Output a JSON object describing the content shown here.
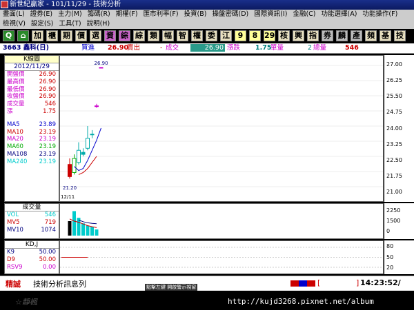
{
  "window": {
    "title": "新世紀贏家 - 101/11/29 - 技術分析"
  },
  "menu": {
    "row1": [
      "畫面(L)",
      "證券(E)",
      "主力(M)",
      "籌碼(R)",
      "期權(F)",
      "匯市利率(F)",
      "投資(B)",
      "操盤密碼(D)",
      "國際資訊(I)",
      "金融(C)",
      "功能選擇(A)",
      "功能操作(F)"
    ],
    "row2": [
      "檢視(V)",
      "設定(S)",
      "工具(T)",
      "說明(H)"
    ]
  },
  "toolbar": {
    "buttons": [
      "Q",
      "⌂",
      "加",
      "櫃",
      "期",
      "價",
      "選",
      "資",
      "綜",
      "綜",
      "類",
      "幅",
      "智",
      "權",
      "委",
      "江",
      "9",
      "8",
      "29",
      "核",
      "興",
      "指",
      "券",
      "麟",
      "產",
      "頻",
      "基",
      "技"
    ]
  },
  "quote": {
    "code_name": "3663 鑫科(日)",
    "bid_label": "買進",
    "bid": "26.90",
    "ask_label": "賣出",
    "ask": "-",
    "trade_label": "成交",
    "trade": "26.90",
    "change_label": "漲跌",
    "change": "1.75",
    "unit_vol_label": "單量",
    "unit_vol": "2",
    "total_vol_label": "總量",
    "total_vol": "546"
  },
  "kline": {
    "title": "K線圖",
    "date": "2012/11/29",
    "stats": [
      {
        "label": "開盤價",
        "value": "26.90"
      },
      {
        "label": "最高價",
        "value": "26.90"
      },
      {
        "label": "最低價",
        "value": "26.90"
      },
      {
        "label": "收盤價",
        "value": "26.90"
      },
      {
        "label": "成交量",
        "value": "546"
      },
      {
        "label": "漲",
        "value": "1.75"
      }
    ],
    "ma": [
      {
        "label": "MA5",
        "value": "23.89",
        "color": "#0000cc"
      },
      {
        "label": "MA10",
        "value": "23.19",
        "color": "#cc0000"
      },
      {
        "label": "MA20",
        "value": "23.19",
        "color": "#cc00cc"
      },
      {
        "label": "MA60",
        "value": "23.19",
        "color": "#00aa00"
      },
      {
        "label": "MA108",
        "value": "23.19",
        "color": "#000080"
      },
      {
        "label": "MA240",
        "value": "23.19",
        "color": "#00cccc"
      }
    ]
  },
  "volume": {
    "title": "成交量",
    "rows": [
      {
        "label": "VOL",
        "value": "546",
        "color": "#00cccc"
      },
      {
        "label": "MV5",
        "value": "719",
        "color": "#cc0000"
      },
      {
        "label": "MV10",
        "value": "1074",
        "color": "#000080"
      }
    ]
  },
  "kd": {
    "title": "KD,J",
    "rows": [
      {
        "label": "K9",
        "value": "50.00",
        "color": "#000080"
      },
      {
        "label": "D9",
        "value": "50.00",
        "color": "#cc0000"
      },
      {
        "label": "RSV9",
        "value": "0.00",
        "color": "#cc00cc"
      }
    ]
  },
  "chart_data": {
    "type": "candlestick",
    "price_top_label": "26.90",
    "price_axis": {
      "ticks": [
        "27.00",
        "26.25",
        "25.50",
        "24.75",
        "24.00",
        "23.25",
        "22.50",
        "21.75",
        "21.00"
      ],
      "ylim": [
        21.0,
        27.0
      ]
    },
    "volume_axis": {
      "ticks": [
        "2250",
        "1500",
        "0"
      ],
      "ylim": [
        0,
        2600
      ]
    },
    "kd_axis": {
      "ticks": [
        "80",
        "50",
        "20"
      ],
      "ylim": [
        0,
        100
      ]
    },
    "x_label": "12/11",
    "low_label": "21.20",
    "candles": [
      {
        "open": 22.1,
        "close": 21.5,
        "high": 22.4,
        "low": 21.4,
        "color": "#cc0000"
      },
      {
        "open": 21.7,
        "close": 22.4,
        "high": 22.6,
        "low": 21.6,
        "color": "#00aa00"
      },
      {
        "open": 22.2,
        "close": 22.8,
        "high": 23.2,
        "low": 22.1,
        "color": "#00aaaa"
      },
      {
        "open": 22.7,
        "close": 22.6,
        "high": 22.9,
        "low": 22.5,
        "color": "#00aaaa"
      },
      {
        "open": 22.9,
        "close": 23.4,
        "high": 24.0,
        "low": 22.8,
        "color": "#00aaaa"
      },
      {
        "open": 23.6,
        "close": 23.6,
        "high": 23.8,
        "low": 23.4,
        "color": "#00aaaa"
      },
      {
        "open": 25.0,
        "close": 25.0,
        "high": 25.1,
        "low": 24.9,
        "color": "#cc00cc"
      },
      {
        "open": 26.9,
        "close": 26.9,
        "high": 26.9,
        "low": 26.9,
        "color": "#cc00cc"
      }
    ],
    "ma5": [
      22.0,
      21.8,
      21.9,
      22.3,
      22.8,
      23.3,
      23.9
    ],
    "ma10": [
      21.6,
      21.7,
      21.9,
      22.2,
      22.5
    ],
    "volumes": [
      {
        "value": 1300,
        "color": "#000000"
      },
      {
        "value": 2200,
        "color": "#00cccc"
      },
      {
        "value": 1600,
        "color": "#00cccc"
      },
      {
        "value": 1100,
        "color": "#00cccc"
      },
      {
        "value": 900,
        "color": "#00cccc"
      },
      {
        "value": 800,
        "color": "#00cccc"
      },
      {
        "value": 550,
        "color": "#00cccc"
      }
    ],
    "mv5_line": [
      1500,
      1300,
      1200,
      1050,
      900,
      800,
      720
    ],
    "mv10_line": [
      1400,
      1250,
      1150,
      1100,
      1070
    ]
  },
  "status": {
    "left_label": "精誠",
    "message": "技術分析訊息列",
    "mid_tag": "點擊左鍵 開啟警示視窗",
    "bracket_open": "[",
    "bracket_close": "]",
    "time": "14:23:52/"
  },
  "footer": {
    "logo_text": "☆靜楓",
    "url": "http://kujd3268.pixnet.net/album"
  }
}
